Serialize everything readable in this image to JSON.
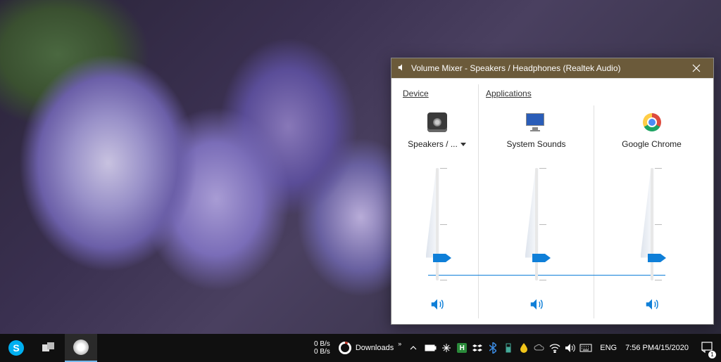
{
  "window": {
    "title": "Volume Mixer - Speakers / Headphones (Realtek Audio)",
    "device_section_label": "Device",
    "apps_section_label": "Applications",
    "channels": [
      {
        "label": "Speakers / ...",
        "has_dropdown": true,
        "volume": 20,
        "muted": false,
        "icon": "speaker-device"
      },
      {
        "label": "System Sounds",
        "has_dropdown": false,
        "volume": 20,
        "muted": false,
        "icon": "system-sounds"
      },
      {
        "label": "Google Chrome",
        "has_dropdown": false,
        "volume": 20,
        "muted": false,
        "icon": "chrome"
      }
    ]
  },
  "taskbar": {
    "net_up": "0 B/s",
    "net_down": "0 B/s",
    "downloads_label": "Downloads",
    "lang": "ENG",
    "time": "7:56 PM",
    "date": "4/15/2020",
    "notif_count": "1"
  }
}
